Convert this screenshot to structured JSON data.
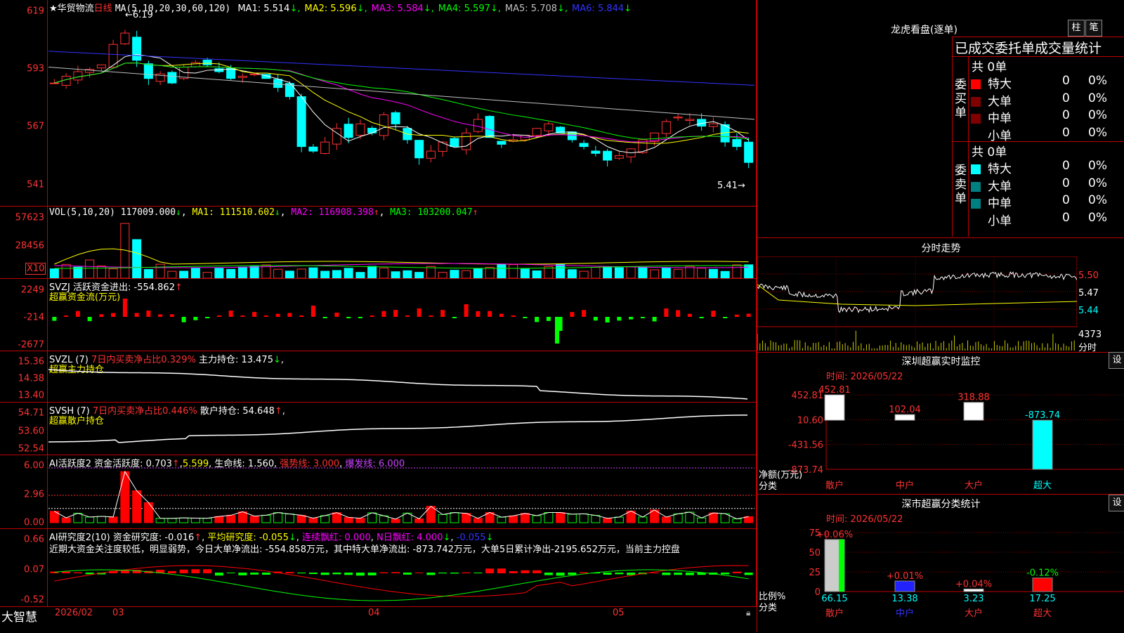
{
  "stock": {
    "name": "华贸物流",
    "period": "日线"
  },
  "main": {
    "y_labels": [
      "619",
      "593",
      "567",
      "541"
    ],
    "ma_head": "MA(5,10,20,30,60,120)",
    "ma": [
      {
        "label": "MA1: 5.514",
        "arrow": "↓",
        "color": "#ffffff"
      },
      {
        "label": "MA2: 5.596",
        "arrow": "↓",
        "color": "#ffff00"
      },
      {
        "label": "MA3: 5.584",
        "arrow": "↓",
        "color": "#ff00ff"
      },
      {
        "label": "MA4: 5.597",
        "arrow": "↓",
        "color": "#00ff00"
      },
      {
        "label": "MA5: 5.708",
        "arrow": "↓",
        "color": "#c0c0c0"
      },
      {
        "label": "MA6: 5.844",
        "arrow": "↓",
        "color": "#3333ff"
      }
    ],
    "high_mark": "6.19",
    "low_mark": "5.41"
  },
  "vol": {
    "y_labels": [
      "57623",
      "28456"
    ],
    "unit": "X10",
    "head": "VOL(5,10,20)",
    "v": "117009.000",
    "ma1": "MA1: 111510.602",
    "ma2": "MA2: 116908.398",
    "ma3": "MA3: 103200.047"
  },
  "svzj": {
    "y_labels": [
      "2249",
      "-214",
      "-2677"
    ],
    "head": "SVZJ  活跃资金进出: -554.862",
    "sub": "超赢资金流(万元)"
  },
  "svzl": {
    "y_labels": [
      "15.36",
      "14.38",
      "13.40"
    ],
    "head": "SVZL (7)",
    "pct": "7日内买卖净占比0.329%",
    "hold": "主力持仓: 13.475",
    "sub": "超赢主力持仓"
  },
  "svsh": {
    "y_labels": [
      "54.71",
      "53.60",
      "52.54"
    ],
    "head": "SVSH (7)",
    "pct": "7日内买卖净占比0.446%",
    "hold": "散户持仓: 54.648",
    "sub": "超赢散户持仓"
  },
  "ai1": {
    "y_labels": [
      "6.00",
      "2.96",
      "0.00"
    ],
    "head": "AI活跃度2",
    "a": "资金活跃度: 0.703",
    "b": "5.599",
    "c": "生命线: 1.560",
    "d": "强势线: 3.000",
    "e": "爆发线: 6.000"
  },
  "ai2": {
    "y_labels": [
      "0.66",
      "0.07",
      "-0.52"
    ],
    "head": "AI研究度2(10)",
    "a": "资金研究度: -0.016",
    "b": "平均研究度: -0.055",
    "c": "连续飘红: 0.000",
    "d": "N日飘红: 4.000",
    "e": "-0.055",
    "text": "近期大资金关注度较低，明显弱势，今日大单净流出: -554.858万元，其中特大单净流出: -873.742万元，大单5日累计净出-2195.652万元，当前主力控盘"
  },
  "bottom": {
    "brand": "大智慧",
    "dates": [
      "2026/02",
      "03",
      "04",
      "05"
    ]
  },
  "dragon": {
    "title": "龙虎看盘(逐单)",
    "btn1": "柱",
    "btn2": "笔",
    "header": "已成交委托单成交量统计",
    "buy_label": "委买单",
    "sell_label": "委卖单",
    "buy_total": "共 0单",
    "sell_total": "共 0单",
    "buy_rows": [
      {
        "name": "特大",
        "val": "0",
        "pct": "0%",
        "color": "#ff0000"
      },
      {
        "name": "大单",
        "val": "0",
        "pct": "0%",
        "color": "#800000"
      },
      {
        "name": "中单",
        "val": "0",
        "pct": "0%",
        "color": "#800000"
      },
      {
        "name": "小单",
        "val": "0",
        "pct": "0%",
        "color": "#000000"
      }
    ],
    "sell_rows": [
      {
        "name": "特大",
        "val": "0",
        "pct": "0%",
        "color": "#00ffff"
      },
      {
        "name": "大单",
        "val": "0",
        "pct": "0%",
        "color": "#008080"
      },
      {
        "name": "中单",
        "val": "0",
        "pct": "0%",
        "color": "#008080"
      },
      {
        "name": "小单",
        "val": "0",
        "pct": "0%",
        "color": "#000000"
      }
    ]
  },
  "intraday": {
    "title": "分时走势",
    "y_labels": [
      "5.50",
      "5.47",
      "5.44"
    ],
    "vol_label": "4373",
    "vol_unit": "分时"
  },
  "sz_monitor": {
    "title": "深圳超赢实时监控",
    "btn": "设",
    "time": "时间: 2026/05/22",
    "y_labels": [
      "452.81",
      "10.60",
      "-431.56",
      "-873.74"
    ],
    "ylabel": "净额(万元)",
    "xlabel": "分类",
    "categories": [
      "散户",
      "中户",
      "大户",
      "超大"
    ],
    "values": [
      "452.81",
      "102.04",
      "318.88",
      "-873.74"
    ]
  },
  "sz_class": {
    "title": "深市超赢分类统计",
    "btn": "设",
    "time": "时间: 2026/05/22",
    "y_labels": [
      "75",
      "50",
      "25",
      "0"
    ],
    "ylabel": "比例%",
    "xlabel": "分类",
    "categories": [
      "散户",
      "中户",
      "大户",
      "超大"
    ],
    "tops": [
      "+0.06%",
      "+0.01%",
      "+0.04%",
      "-0.12%"
    ],
    "values": [
      "66.15",
      "13.38",
      "3.23",
      "17.25"
    ]
  },
  "chart_data": [
    {
      "type": "candlestick",
      "title": "华贸物流 日线",
      "ylim": [
        5.41,
        6.19
      ],
      "high": 6.19,
      "low": 5.41,
      "close_last": 5.514,
      "ma_values": {
        "MA1": 5.514,
        "MA2": 5.596,
        "MA3": 5.584,
        "MA4": 5.597,
        "MA5": 5.708,
        "MA6": 5.844
      }
    },
    {
      "type": "bar",
      "title": "VOL(5,10,20)",
      "last": 117009.0,
      "ma": [
        111510.602,
        116908.398,
        103200.047
      ]
    },
    {
      "type": "bar",
      "title": "深圳超赢实时监控",
      "categories": [
        "散户",
        "中户",
        "大户",
        "超大"
      ],
      "values": [
        452.81,
        102.04,
        318.88,
        -873.74
      ],
      "ylim": [
        -873.74,
        452.81
      ]
    },
    {
      "type": "bar",
      "title": "深市超赢分类统计",
      "categories": [
        "散户",
        "中户",
        "大户",
        "超大"
      ],
      "values": [
        66.15,
        13.38,
        3.23,
        17.25
      ],
      "ylim": [
        0,
        75
      ]
    }
  ]
}
